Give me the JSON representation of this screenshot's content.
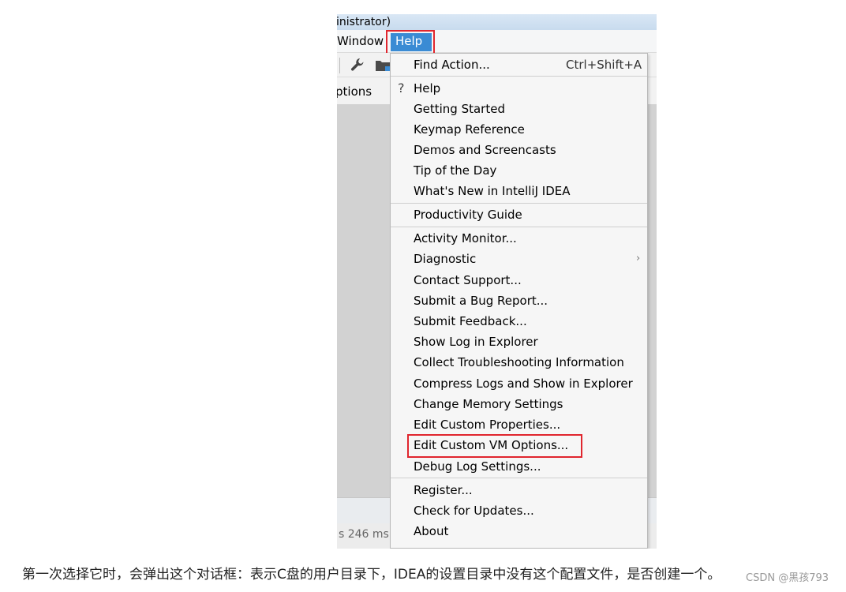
{
  "window": {
    "title_fragment": "inistrator)",
    "options_fragment": "ptions",
    "status_fragment": "s 246 ms"
  },
  "menubar": {
    "window_label": "Window",
    "help_label": "Help"
  },
  "toolbar": {
    "icons": [
      "wrench-icon",
      "folder-icon"
    ]
  },
  "help_menu": {
    "find_action": {
      "label": "Find Action...",
      "shortcut": "Ctrl+Shift+A"
    },
    "group1": [
      "Help",
      "Getting Started",
      "Keymap Reference",
      "Demos and Screencasts",
      "Tip of the Day",
      "What's New in IntelliJ IDEA"
    ],
    "group2": [
      "Productivity Guide"
    ],
    "group3": [
      "Activity Monitor...",
      "Diagnostic",
      "Contact Support...",
      "Submit a Bug Report...",
      "Submit Feedback...",
      "Show Log in Explorer",
      "Collect Troubleshooting Information",
      "Compress Logs and Show in Explorer",
      "Change Memory Settings",
      "Edit Custom Properties...",
      "Edit Custom VM Options...",
      "Debug Log Settings..."
    ],
    "group4": [
      "Register...",
      "Check for Updates...",
      "About"
    ],
    "submenu_arrow": "›",
    "help_glyph": "?"
  },
  "caption": {
    "text": "第一次选择它时，会弹出这个对话框：表示C盘的用户目录下，IDEA的设置目录中没有这个配置文件，是否创建一个。",
    "watermark": "CSDN @黑孩793"
  },
  "colors": {
    "highlight": "#e0262e",
    "menu_selected": "#3a8bd4"
  }
}
